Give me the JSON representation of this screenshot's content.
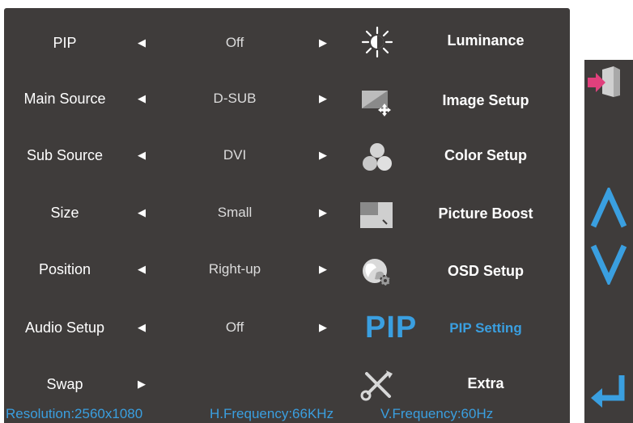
{
  "settings": [
    {
      "label": "PIP",
      "value": "Off",
      "left_arrow": true,
      "right_arrow": true
    },
    {
      "label": "Main Source",
      "value": "D-SUB",
      "left_arrow": true,
      "right_arrow": true
    },
    {
      "label": "Sub Source",
      "value": "DVI",
      "left_arrow": true,
      "right_arrow": true
    },
    {
      "label": "Size",
      "value": "Small",
      "left_arrow": true,
      "right_arrow": true
    },
    {
      "label": "Position",
      "value": "Right-up",
      "left_arrow": true,
      "right_arrow": true
    },
    {
      "label": "Audio Setup",
      "value": "Off",
      "left_arrow": true,
      "right_arrow": true
    },
    {
      "label": "Swap",
      "value": "",
      "left_arrow": false,
      "right_arrow": true
    }
  ],
  "arrows": {
    "left": "◀",
    "right": "▶"
  },
  "menu": [
    {
      "label": "Luminance",
      "icon": "brightness-icon",
      "active": false
    },
    {
      "label": "Image Setup",
      "icon": "image-setup-icon",
      "active": false
    },
    {
      "label": "Color Setup",
      "icon": "color-setup-icon",
      "active": false
    },
    {
      "label": "Picture Boost",
      "icon": "picture-boost-icon",
      "active": false
    },
    {
      "label": "OSD Setup",
      "icon": "osd-setup-icon",
      "active": false
    },
    {
      "label": "PIP Setting",
      "icon": "pip-icon",
      "icon_text": "PIP",
      "active": true
    },
    {
      "label": "Extra",
      "icon": "extra-tools-icon",
      "active": false
    }
  ],
  "status": {
    "resolution": "Resolution:2560x1080",
    "h_frequency": "H.Frequency:66KHz",
    "v_frequency": "V.Frequency:60Hz"
  },
  "side_buttons": [
    {
      "name": "exit-icon"
    },
    {
      "name": "up-arrow-icon"
    },
    {
      "name": "down-arrow-icon"
    },
    {
      "name": "enter-icon"
    }
  ],
  "colors": {
    "panel_bg": "#3f3c3b",
    "accent": "#3a9fe0",
    "text": "#ffffff",
    "exit_pink": "#e0407c"
  }
}
